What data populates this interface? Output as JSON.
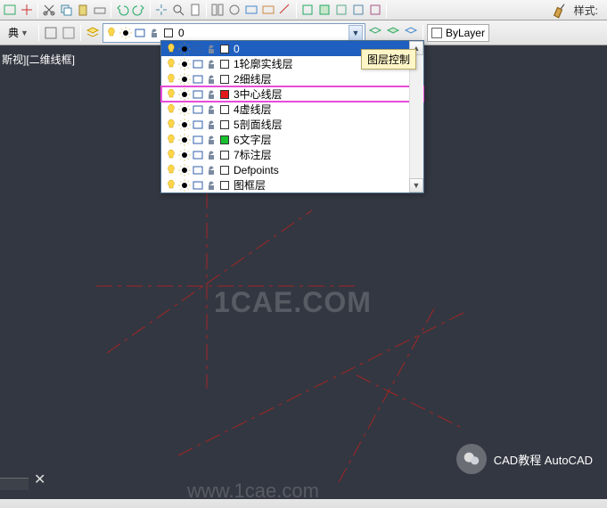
{
  "style": {
    "label": "样式:",
    "brush": "format-brush"
  },
  "workspace": {
    "label": "典"
  },
  "layer_combo": {
    "current": "0",
    "color": "#ffffff"
  },
  "layer_tooltip": "图层控制",
  "bylayer": {
    "label": "ByLayer",
    "color": "#ffffff"
  },
  "view_label": "斯视][二维线框]",
  "layers": [
    {
      "name": "0",
      "color": "#ffffff",
      "selected": true,
      "highlighted": false
    },
    {
      "name": "1轮廓实线层",
      "color": "#ffffff",
      "selected": false,
      "highlighted": false
    },
    {
      "name": "2细线层",
      "color": "#ffffff",
      "selected": false,
      "highlighted": false
    },
    {
      "name": "3中心线层",
      "color": "#e21a1a",
      "selected": false,
      "highlighted": true
    },
    {
      "name": "4虚线层",
      "color": "#ffffff",
      "selected": false,
      "highlighted": false
    },
    {
      "name": "5剖面线层",
      "color": "#ffffff",
      "selected": false,
      "highlighted": false
    },
    {
      "name": "6文字层",
      "color": "#18c22e",
      "selected": false,
      "highlighted": false
    },
    {
      "name": "7标注层",
      "color": "#ffffff",
      "selected": false,
      "highlighted": false
    },
    {
      "name": "Defpoints",
      "color": "#ffffff",
      "selected": false,
      "highlighted": false
    },
    {
      "name": "图框层",
      "color": "#ffffff",
      "selected": false,
      "highlighted": false
    }
  ],
  "watermark1": "1CAE.COM",
  "watermark2": "www.1cae.com",
  "credit": "CAD教程 AutoCAD"
}
